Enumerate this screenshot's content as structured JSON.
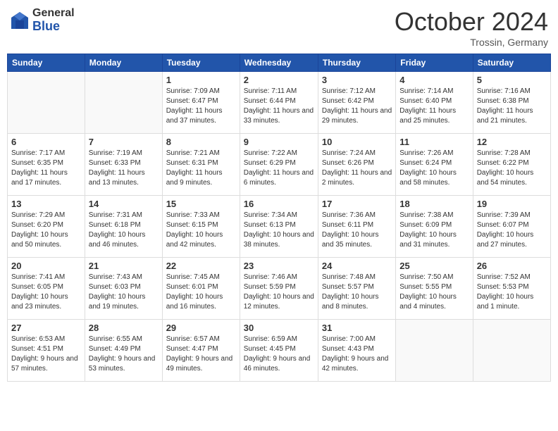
{
  "header": {
    "logo_line1": "General",
    "logo_line2": "Blue",
    "month_title": "October 2024",
    "location": "Trossin, Germany"
  },
  "days_of_week": [
    "Sunday",
    "Monday",
    "Tuesday",
    "Wednesday",
    "Thursday",
    "Friday",
    "Saturday"
  ],
  "weeks": [
    [
      {
        "day": "",
        "info": ""
      },
      {
        "day": "",
        "info": ""
      },
      {
        "day": "1",
        "info": "Sunrise: 7:09 AM\nSunset: 6:47 PM\nDaylight: 11 hours and 37 minutes."
      },
      {
        "day": "2",
        "info": "Sunrise: 7:11 AM\nSunset: 6:44 PM\nDaylight: 11 hours and 33 minutes."
      },
      {
        "day": "3",
        "info": "Sunrise: 7:12 AM\nSunset: 6:42 PM\nDaylight: 11 hours and 29 minutes."
      },
      {
        "day": "4",
        "info": "Sunrise: 7:14 AM\nSunset: 6:40 PM\nDaylight: 11 hours and 25 minutes."
      },
      {
        "day": "5",
        "info": "Sunrise: 7:16 AM\nSunset: 6:38 PM\nDaylight: 11 hours and 21 minutes."
      }
    ],
    [
      {
        "day": "6",
        "info": "Sunrise: 7:17 AM\nSunset: 6:35 PM\nDaylight: 11 hours and 17 minutes."
      },
      {
        "day": "7",
        "info": "Sunrise: 7:19 AM\nSunset: 6:33 PM\nDaylight: 11 hours and 13 minutes."
      },
      {
        "day": "8",
        "info": "Sunrise: 7:21 AM\nSunset: 6:31 PM\nDaylight: 11 hours and 9 minutes."
      },
      {
        "day": "9",
        "info": "Sunrise: 7:22 AM\nSunset: 6:29 PM\nDaylight: 11 hours and 6 minutes."
      },
      {
        "day": "10",
        "info": "Sunrise: 7:24 AM\nSunset: 6:26 PM\nDaylight: 11 hours and 2 minutes."
      },
      {
        "day": "11",
        "info": "Sunrise: 7:26 AM\nSunset: 6:24 PM\nDaylight: 10 hours and 58 minutes."
      },
      {
        "day": "12",
        "info": "Sunrise: 7:28 AM\nSunset: 6:22 PM\nDaylight: 10 hours and 54 minutes."
      }
    ],
    [
      {
        "day": "13",
        "info": "Sunrise: 7:29 AM\nSunset: 6:20 PM\nDaylight: 10 hours and 50 minutes."
      },
      {
        "day": "14",
        "info": "Sunrise: 7:31 AM\nSunset: 6:18 PM\nDaylight: 10 hours and 46 minutes."
      },
      {
        "day": "15",
        "info": "Sunrise: 7:33 AM\nSunset: 6:15 PM\nDaylight: 10 hours and 42 minutes."
      },
      {
        "day": "16",
        "info": "Sunrise: 7:34 AM\nSunset: 6:13 PM\nDaylight: 10 hours and 38 minutes."
      },
      {
        "day": "17",
        "info": "Sunrise: 7:36 AM\nSunset: 6:11 PM\nDaylight: 10 hours and 35 minutes."
      },
      {
        "day": "18",
        "info": "Sunrise: 7:38 AM\nSunset: 6:09 PM\nDaylight: 10 hours and 31 minutes."
      },
      {
        "day": "19",
        "info": "Sunrise: 7:39 AM\nSunset: 6:07 PM\nDaylight: 10 hours and 27 minutes."
      }
    ],
    [
      {
        "day": "20",
        "info": "Sunrise: 7:41 AM\nSunset: 6:05 PM\nDaylight: 10 hours and 23 minutes."
      },
      {
        "day": "21",
        "info": "Sunrise: 7:43 AM\nSunset: 6:03 PM\nDaylight: 10 hours and 19 minutes."
      },
      {
        "day": "22",
        "info": "Sunrise: 7:45 AM\nSunset: 6:01 PM\nDaylight: 10 hours and 16 minutes."
      },
      {
        "day": "23",
        "info": "Sunrise: 7:46 AM\nSunset: 5:59 PM\nDaylight: 10 hours and 12 minutes."
      },
      {
        "day": "24",
        "info": "Sunrise: 7:48 AM\nSunset: 5:57 PM\nDaylight: 10 hours and 8 minutes."
      },
      {
        "day": "25",
        "info": "Sunrise: 7:50 AM\nSunset: 5:55 PM\nDaylight: 10 hours and 4 minutes."
      },
      {
        "day": "26",
        "info": "Sunrise: 7:52 AM\nSunset: 5:53 PM\nDaylight: 10 hours and 1 minute."
      }
    ],
    [
      {
        "day": "27",
        "info": "Sunrise: 6:53 AM\nSunset: 4:51 PM\nDaylight: 9 hours and 57 minutes."
      },
      {
        "day": "28",
        "info": "Sunrise: 6:55 AM\nSunset: 4:49 PM\nDaylight: 9 hours and 53 minutes."
      },
      {
        "day": "29",
        "info": "Sunrise: 6:57 AM\nSunset: 4:47 PM\nDaylight: 9 hours and 49 minutes."
      },
      {
        "day": "30",
        "info": "Sunrise: 6:59 AM\nSunset: 4:45 PM\nDaylight: 9 hours and 46 minutes."
      },
      {
        "day": "31",
        "info": "Sunrise: 7:00 AM\nSunset: 4:43 PM\nDaylight: 9 hours and 42 minutes."
      },
      {
        "day": "",
        "info": ""
      },
      {
        "day": "",
        "info": ""
      }
    ]
  ]
}
